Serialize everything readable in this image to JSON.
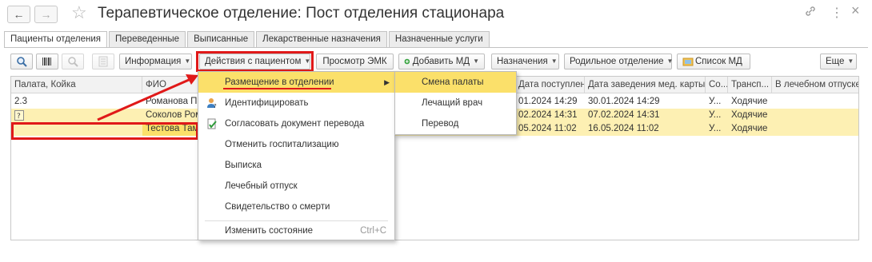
{
  "window": {
    "title": "Терапевтическое отделение: Пост отделения стационара",
    "back": "←",
    "forward": "→",
    "link_icon": "🔗",
    "more_icon": "⋮",
    "close_icon": "×"
  },
  "tabs": [
    "Пациенты отделения",
    "Переведенные",
    "Выписанные",
    "Лекарственные назначения",
    "Назначенные услуги"
  ],
  "toolbar": {
    "info": "Информация",
    "patient_actions": "Действия с пациентом",
    "emk": "Просмотр ЭМК",
    "add_md": "Добавить МД",
    "assignments": "Назначения",
    "maternity": "Родильное отделение",
    "md_list": "Список МД",
    "more": "Еще"
  },
  "table": {
    "columns": [
      "Палата, Койка",
      "ФИО",
      "",
      "",
      "Дата поступления",
      "Дата заведения мед. карты",
      "Со...",
      "Трансп...",
      "В лечебном отпуске"
    ],
    "rows": [
      {
        "bed": "2.3",
        "name": "Романова По",
        "admit": "01.2024 14:29",
        "card": "30.01.2024 14:29",
        "status": "У...",
        "transport": "Ходячие"
      },
      {
        "bed": "",
        "name": "Соколов Ром",
        "admit": "02.2024 14:31",
        "card": "07.02.2024 14:31",
        "status": "У...",
        "transport": "Ходячие"
      },
      {
        "bed": "",
        "name": "Тестова Там",
        "admit": "05.2024 11:02",
        "card": "16.05.2024 11:02",
        "status": "У...",
        "transport": "Ходячие"
      }
    ]
  },
  "actions_menu": {
    "items": [
      {
        "label": "Размещение в отделении",
        "icon": "",
        "shortcut": "",
        "submenu": "▶"
      },
      {
        "label": "Идентифицировать",
        "icon": "person-question-icon",
        "shortcut": "",
        "submenu": ""
      },
      {
        "label": "Согласовать документ перевода",
        "icon": "document-check-icon",
        "shortcut": "",
        "submenu": ""
      },
      {
        "label": "Отменить госпитализацию",
        "icon": "",
        "shortcut": "",
        "submenu": ""
      },
      {
        "label": "Выписка",
        "icon": "",
        "shortcut": "",
        "submenu": ""
      },
      {
        "label": "Лечебный отпуск",
        "icon": "",
        "shortcut": "",
        "submenu": ""
      },
      {
        "label": "Свидетельство о смерти",
        "icon": "",
        "shortcut": "",
        "submenu": ""
      },
      {
        "label": "Изменить состояние",
        "icon": "",
        "shortcut": "Ctrl+C",
        "submenu": ""
      }
    ]
  },
  "sub_menu": {
    "items": [
      "Смена палаты",
      "Лечащий врач",
      "Перевод"
    ]
  },
  "colors": {
    "selection": "#fbe06a",
    "row_highlight": "#fdf0b3",
    "annotation": "#e01919"
  }
}
